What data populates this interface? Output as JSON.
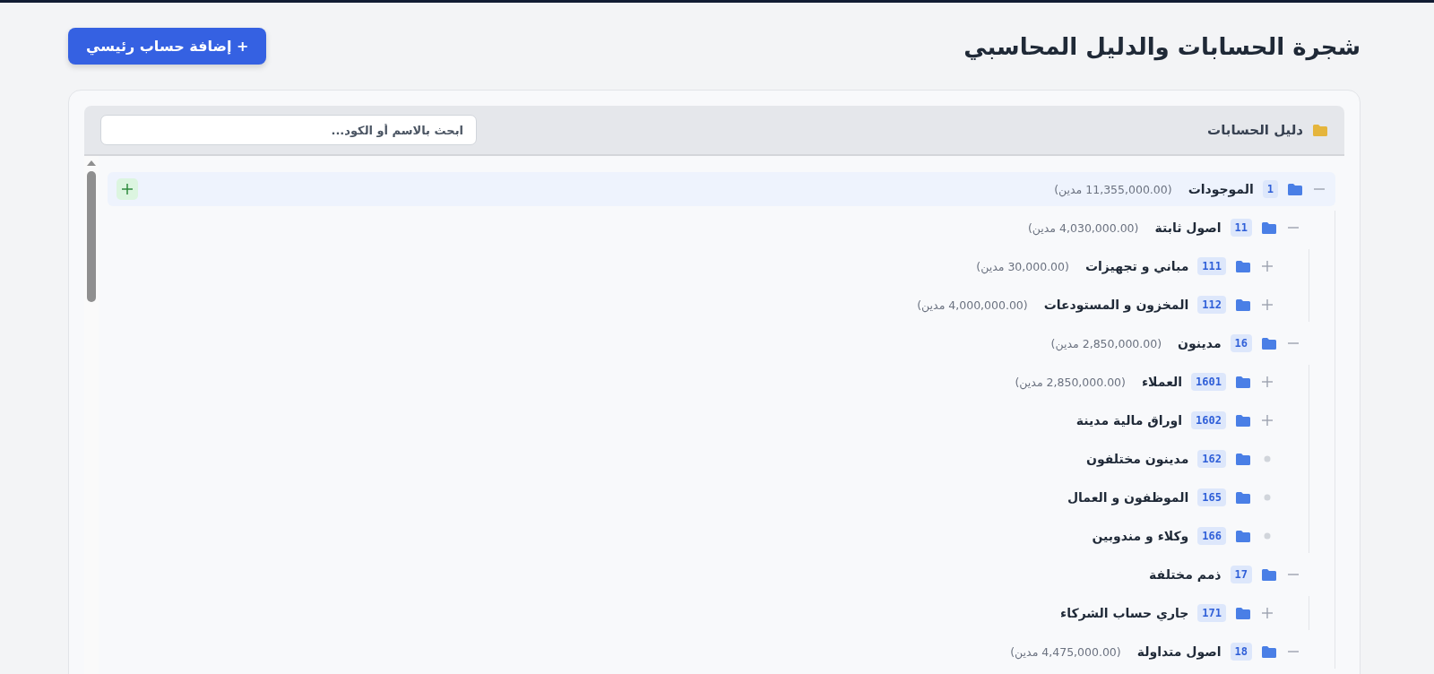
{
  "page": {
    "title": "شجرة الحسابات والدليل المحاسبي",
    "add_button": "+ إضافة حساب رئيسي"
  },
  "panel": {
    "title": "دليل الحسابات",
    "search": {
      "placeholder": "ابحث بالاسم أو الكود..."
    }
  },
  "tree": [
    {
      "kind": "branch",
      "expanded": true,
      "selected": true,
      "code": "1",
      "name": "الموجودات",
      "balance": "(11,355,000.00 مدين)",
      "children": [
        {
          "kind": "branch",
          "expanded": true,
          "selected": false,
          "code": "11",
          "name": "اصول ثابتة",
          "balance": "(4,030,000.00 مدين)",
          "children": [
            {
              "kind": "branch",
              "expanded": false,
              "selected": false,
              "code": "111",
              "name": "مباني و تجهيزات",
              "balance": "(30,000.00 مدين)"
            },
            {
              "kind": "branch",
              "expanded": false,
              "selected": false,
              "code": "112",
              "name": "المخزون و المستودعات",
              "balance": "(4,000,000.00 مدين)"
            }
          ]
        },
        {
          "kind": "branch",
          "expanded": true,
          "selected": false,
          "code": "16",
          "name": "مدينون",
          "balance": "(2,850,000.00 مدين)",
          "children": [
            {
              "kind": "branch",
              "expanded": false,
              "selected": false,
              "code": "1601",
              "name": "العملاء",
              "balance": "(2,850,000.00 مدين)"
            },
            {
              "kind": "branch",
              "expanded": false,
              "selected": false,
              "code": "1602",
              "name": "اوراق مالية مدينة"
            },
            {
              "kind": "leaf",
              "selected": false,
              "code": "162",
              "name": "مدينون مختلفون"
            },
            {
              "kind": "leaf",
              "selected": false,
              "code": "165",
              "name": "الموظفون و العمال"
            },
            {
              "kind": "leaf",
              "selected": false,
              "code": "166",
              "name": "وكلاء و مندوبين"
            }
          ]
        },
        {
          "kind": "branch",
          "expanded": true,
          "selected": false,
          "code": "17",
          "name": "ذمم مختلفة",
          "children": [
            {
              "kind": "branch",
              "expanded": false,
              "selected": false,
              "code": "171",
              "name": "جاري حساب الشركاء"
            }
          ]
        },
        {
          "kind": "branch",
          "expanded": true,
          "selected": false,
          "code": "18",
          "name": "اصول متداولة",
          "balance": "(4,475,000.00 مدين)"
        }
      ]
    }
  ]
}
